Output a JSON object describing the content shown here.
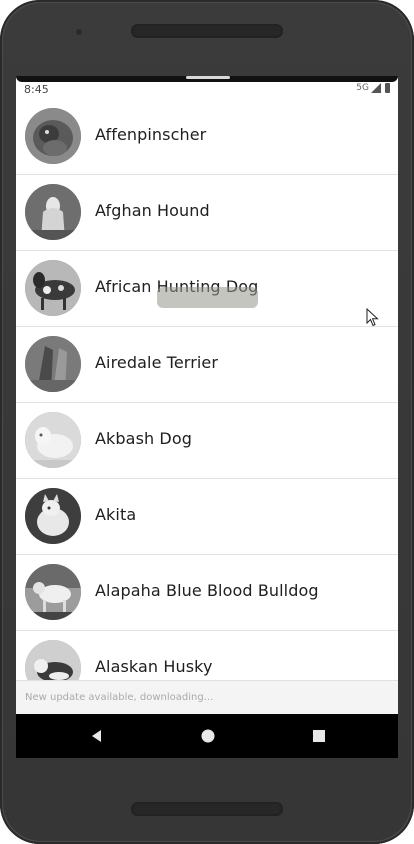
{
  "status_bar": {
    "time": "8:45",
    "network": "5G"
  },
  "breeds": [
    {
      "name": "Affenpinscher",
      "photo": "affenpinscher-photo"
    },
    {
      "name": "Afghan Hound",
      "photo": "afghan-hound-photo"
    },
    {
      "name": "African Hunting Dog",
      "photo": "african-hunting-dog-photo"
    },
    {
      "name": "Airedale Terrier",
      "photo": "airedale-terrier-photo"
    },
    {
      "name": "Akbash Dog",
      "photo": "akbash-dog-photo"
    },
    {
      "name": "Akita",
      "photo": "akita-photo"
    },
    {
      "name": "Alapaha Blue Blood Bulldog",
      "photo": "alapaha-blue-blood-bulldog-photo"
    },
    {
      "name": "Alaskan Husky",
      "photo": "alaskan-husky-photo"
    }
  ],
  "update_banner": {
    "text": "New update available, downloading..."
  },
  "nav_bar": {
    "back_icon": "back-triangle-icon",
    "home_icon": "home-circle-icon",
    "recents_icon": "recents-square-icon"
  }
}
